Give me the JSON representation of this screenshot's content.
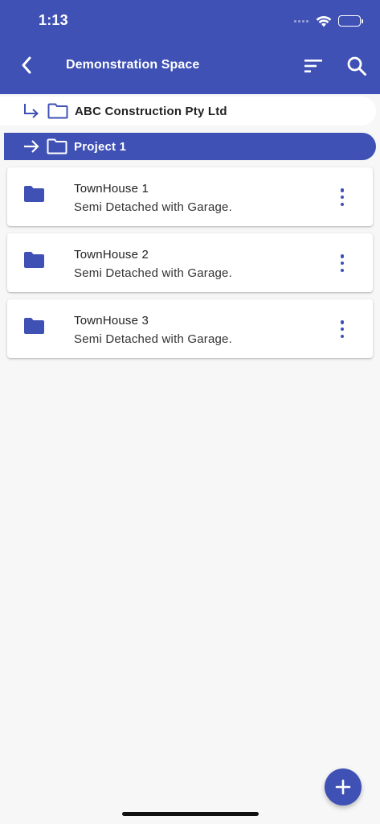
{
  "status_bar": {
    "time": "1:13"
  },
  "app_bar": {
    "title": "Demonstration Space",
    "back_icon": "chevron-left-icon",
    "sort_icon": "sort-icon",
    "search_icon": "search-icon"
  },
  "breadcrumb": {
    "parent": {
      "label": "ABC Construction Pty Ltd",
      "icon": "subdirectory-arrow-icon"
    },
    "current": {
      "label": "Project 1",
      "icon": "arrow-right-icon"
    }
  },
  "items": [
    {
      "title": "TownHouse 1",
      "subtitle": "Semi Detached with Garage."
    },
    {
      "title": "TownHouse 2",
      "subtitle": "Semi Detached with Garage."
    },
    {
      "title": "TownHouse 3",
      "subtitle": "Semi Detached with Garage."
    }
  ],
  "fab": {
    "icon": "plus-icon"
  },
  "colors": {
    "primary": "#3f51b5",
    "background": "#f7f7f7",
    "card": "#ffffff"
  }
}
